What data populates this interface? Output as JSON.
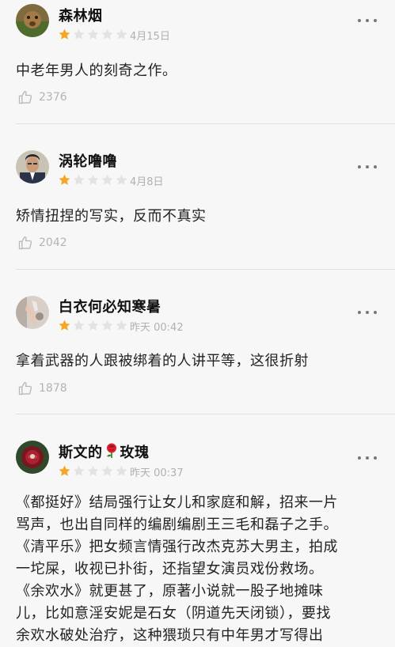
{
  "reviews": [
    {
      "username": "森林烟",
      "rating": 1,
      "date": "4月15日",
      "content": "中老年男人的刻奇之作。",
      "likes": "2376"
    },
    {
      "username": "涡轮噜噜",
      "rating": 1,
      "date": "4月8日",
      "content": "矫情扭捏的写实，反而不真实",
      "likes": "2042"
    },
    {
      "username": "白衣何必知寒暑",
      "rating": 1,
      "date": "昨天 00:42",
      "content": "拿着武器的人跟被绑着的人讲平等，这很折射",
      "likes": "1878"
    },
    {
      "username_prefix": "斯文的",
      "username_suffix": "玫瑰",
      "rating": 1,
      "date": "昨天 00:37",
      "content_lines": [
        "《都挺好》结局强行让女儿和家庭和解，招来一片",
        "骂声，也出自同样的编剧编剧王三毛和磊子之手。",
        "《清平乐》把女频言情强行改杰克苏大男主，拍成",
        "一坨屎，收视已扑街，还指望女演员戏份救场。",
        "《余欢水》就更甚了，原著小说就一股子地摊味",
        "儿，比如意淫安妮是石女（阴道先天闭锁），要找",
        "余欢水破处治疗，这种猥琐只有中年男才写得出"
      ]
    }
  ],
  "colors": {
    "star_filled": "#f5a623",
    "star_empty": "#e3e3e3",
    "text_secondary": "#b0b0b0",
    "divider": "#e2e2e2"
  },
  "icons": {
    "more": "more-dots-icon",
    "like": "thumbs-up-icon",
    "rose": "rose-emoji-icon"
  }
}
